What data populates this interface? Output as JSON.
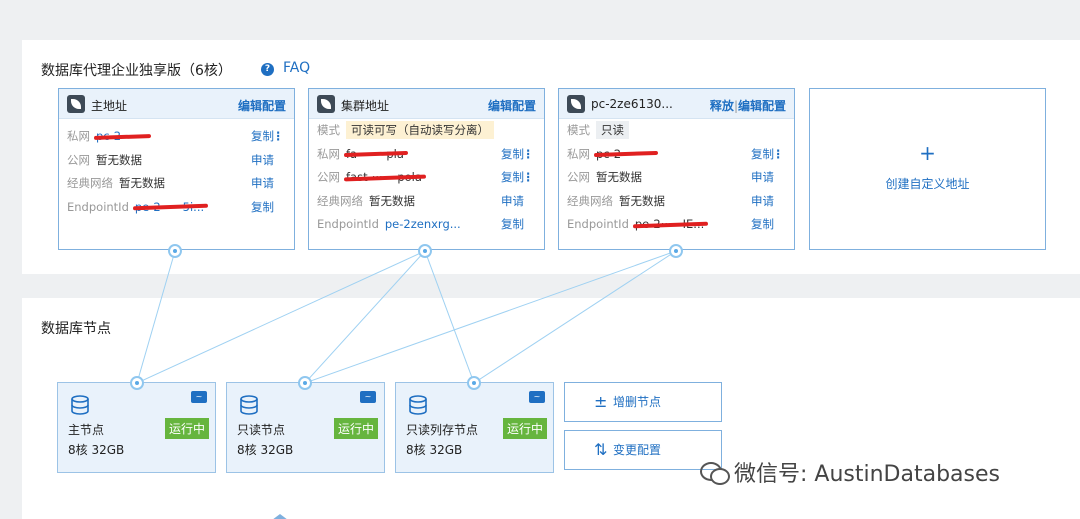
{
  "proxy": {
    "title": "数据库代理企业独享版（6核）",
    "faq_icon": "?",
    "faq": "FAQ",
    "cards": [
      {
        "title": "主地址",
        "action": "编辑配置",
        "rows": [
          {
            "k": "私网",
            "v": "pc-2·······",
            "act": "复制",
            "more": "⋮"
          },
          {
            "k": "公网",
            "v": "暂无数据",
            "act": "申请"
          },
          {
            "k": "经典网络",
            "v": "暂无数据",
            "act": "申请"
          },
          {
            "k": "EndpointId",
            "v": "pe-2······5i...",
            "act": "复制"
          }
        ]
      },
      {
        "title": "集群地址",
        "action": "编辑配置",
        "rows": [
          {
            "k": "模式",
            "v": "可读可写（自动读写分离）"
          },
          {
            "k": "私网",
            "v": "fa········pla",
            "act": "复制",
            "more": "⋮"
          },
          {
            "k": "公网",
            "v": "fast-·······pola",
            "act": "复制",
            "more": "⋮"
          },
          {
            "k": "经典网络",
            "v": "暂无数据",
            "act": "申请"
          },
          {
            "k": "EndpointId",
            "v": "pe-2zenxrg...",
            "act": "复制"
          }
        ]
      },
      {
        "title": "pc-2ze6130...",
        "action_a": "释放",
        "action_b": "编辑配置",
        "rows": [
          {
            "k": "模式",
            "v": "只读"
          },
          {
            "k": "私网",
            "v": "pc-2·········",
            "act": "复制",
            "more": "⋮"
          },
          {
            "k": "公网",
            "v": "暂无数据",
            "act": "申请"
          },
          {
            "k": "经典网络",
            "v": "暂无数据",
            "act": "申请"
          },
          {
            "k": "EndpointId",
            "v": "pe-2······IE...",
            "act": "复制"
          }
        ]
      }
    ],
    "create_plus": "+",
    "create_label": "创建自定义地址"
  },
  "nodes_section": {
    "title": "数据库节点",
    "nodes": [
      {
        "name": "主节点",
        "spec": "8核 32GB",
        "status": "运行中"
      },
      {
        "name": "只读节点",
        "spec": "8核 32GB",
        "status": "运行中"
      },
      {
        "name": "只读列存节点",
        "spec": "8核 32GB",
        "status": "运行中"
      }
    ],
    "add_remove_icon": "±",
    "add_remove": "增删节点",
    "change_config_icon": "⇅",
    "change_config": "变更配置"
  },
  "watermark": "微信号: AustinDatabases",
  "colors": {
    "accent": "#1f6fc2",
    "status_green": "#66b53e",
    "card_border": "#7fb0de",
    "header_bg": "#e9f2fb"
  }
}
